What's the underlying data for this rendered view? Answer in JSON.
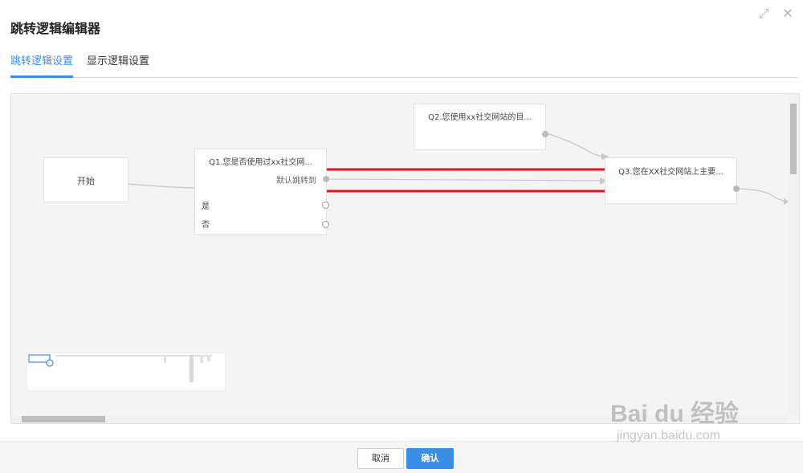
{
  "dialog": {
    "title": "跳转逻辑编辑器"
  },
  "tabs": [
    {
      "label": "跳转逻辑设置",
      "active": true
    },
    {
      "label": "显示逻辑设置",
      "active": false
    }
  ],
  "flow": {
    "start_label": "开始",
    "q1": {
      "title": "Q1.您是否使用过xx社交网...",
      "default_jump": "默认跳转到",
      "options": [
        "是",
        "否"
      ]
    },
    "q2": {
      "title": "Q2.您使用xx社交网站的目..."
    },
    "q3": {
      "title": "Q3.您在XX社交网站上主要..."
    }
  },
  "footer": {
    "cancel_label": "取消",
    "confirm_label": "确认"
  },
  "watermark": {
    "brand": "Bai du 经验",
    "url": "jingyan.baidu.com"
  },
  "colors": {
    "accent": "#3a8ee6",
    "highlight_box": "#e0141e"
  }
}
